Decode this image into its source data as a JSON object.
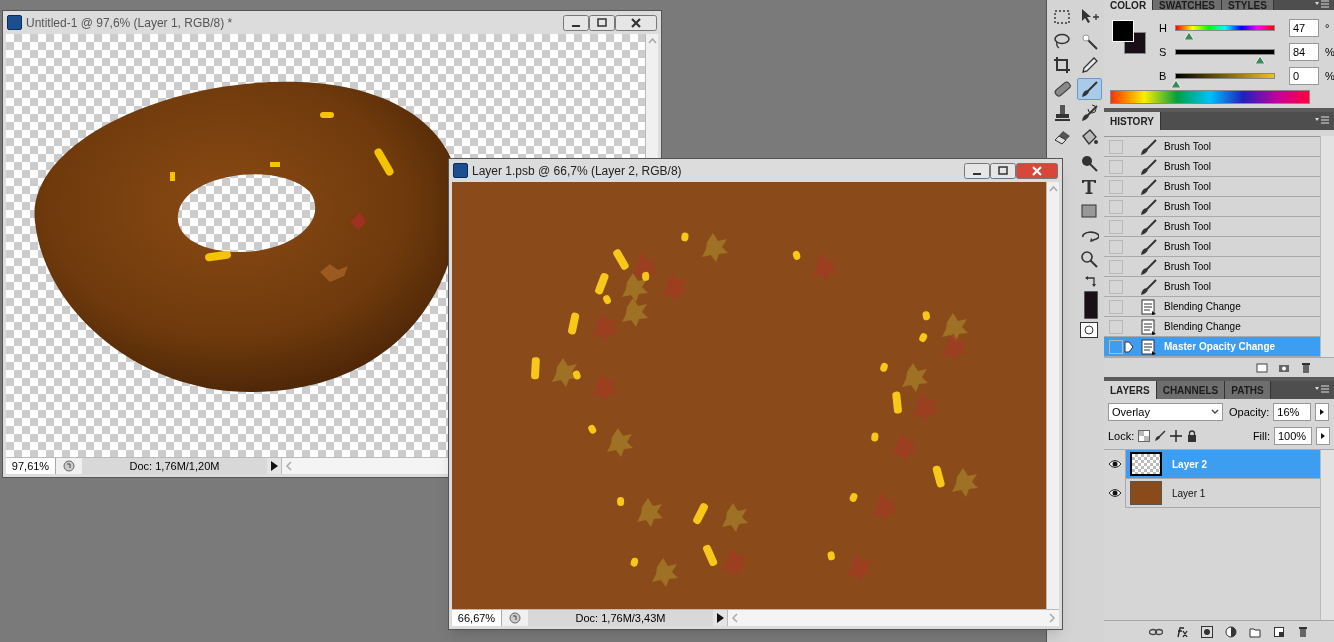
{
  "documents": [
    {
      "title": "Untitled-1 @ 97,6% (Layer 1, RGB/8) *",
      "active": false,
      "kind": "donut",
      "zoom": "97,61%",
      "doc_info": "Doc: 1,76M/1,20M"
    },
    {
      "title": "Layer 1.psb @ 66,7% (Layer 2, RGB/8)",
      "active": true,
      "kind": "texture",
      "zoom": "66,67%",
      "doc_info": "Doc: 1,76M/3,43M"
    }
  ],
  "tools": [
    {
      "kind": "marquee",
      "selected": false
    },
    {
      "kind": "move",
      "selected": false
    },
    {
      "kind": "lasso",
      "selected": false
    },
    {
      "kind": "wand",
      "selected": false
    },
    {
      "kind": "crop",
      "selected": false
    },
    {
      "kind": "eyedropper",
      "selected": false
    },
    {
      "kind": "bandage",
      "selected": false
    },
    {
      "kind": "brush",
      "selected": true
    },
    {
      "kind": "stamp",
      "selected": false
    },
    {
      "kind": "history-brush",
      "selected": false
    },
    {
      "kind": "eraser",
      "selected": false
    },
    {
      "kind": "bucket",
      "selected": false
    },
    {
      "kind": "dodge",
      "selected": false
    },
    {
      "kind": "type",
      "selected": false
    },
    {
      "kind": "shape",
      "selected": false
    },
    {
      "kind": "rotate",
      "selected": false
    },
    {
      "kind": "zoom",
      "selected": false
    }
  ],
  "color_panel": {
    "tabs": [
      {
        "label": "COLOR",
        "selected": true
      },
      {
        "label": "SWATCHES",
        "selected": false
      },
      {
        "label": "STYLES",
        "selected": false
      }
    ],
    "sliders": [
      {
        "label": "H",
        "value": "47",
        "unit": "°",
        "level": 0.13
      },
      {
        "label": "S",
        "value": "84",
        "unit": "%",
        "level": 0.84
      },
      {
        "label": "B",
        "value": "0",
        "unit": "%",
        "level": 0
      }
    ]
  },
  "history_panel": {
    "tabs": [
      {
        "label": "HISTORY",
        "selected": true
      }
    ],
    "items": [
      {
        "label": "Brush Tool",
        "kind": "brush",
        "selected": false
      },
      {
        "label": "Brush Tool",
        "kind": "brush",
        "selected": false
      },
      {
        "label": "Brush Tool",
        "kind": "brush",
        "selected": false
      },
      {
        "label": "Brush Tool",
        "kind": "brush",
        "selected": false
      },
      {
        "label": "Brush Tool",
        "kind": "brush",
        "selected": false
      },
      {
        "label": "Brush Tool",
        "kind": "brush",
        "selected": false
      },
      {
        "label": "Brush Tool",
        "kind": "brush",
        "selected": false
      },
      {
        "label": "Brush Tool",
        "kind": "brush",
        "selected": false
      },
      {
        "label": "Blending Change",
        "kind": "document",
        "selected": false
      },
      {
        "label": "Blending Change",
        "kind": "document",
        "selected": false
      },
      {
        "label": "Master Opacity Change",
        "kind": "document",
        "selected": true
      }
    ]
  },
  "layers_panel": {
    "tabs": [
      {
        "label": "LAYERS",
        "selected": true
      },
      {
        "label": "CHANNELS",
        "selected": false
      },
      {
        "label": "PATHS",
        "selected": false
      }
    ],
    "blend_mode": "Overlay",
    "opacity_label": "Opacity:",
    "opacity": "16%",
    "lock_label": "Lock:",
    "fill_label": "Fill:",
    "fill": "100%",
    "layers": [
      {
        "name": "Layer 2",
        "kind": "transparent",
        "visible": true,
        "selected": true
      },
      {
        "name": "Layer 1",
        "kind": "brown",
        "visible": true,
        "selected": false
      }
    ]
  }
}
